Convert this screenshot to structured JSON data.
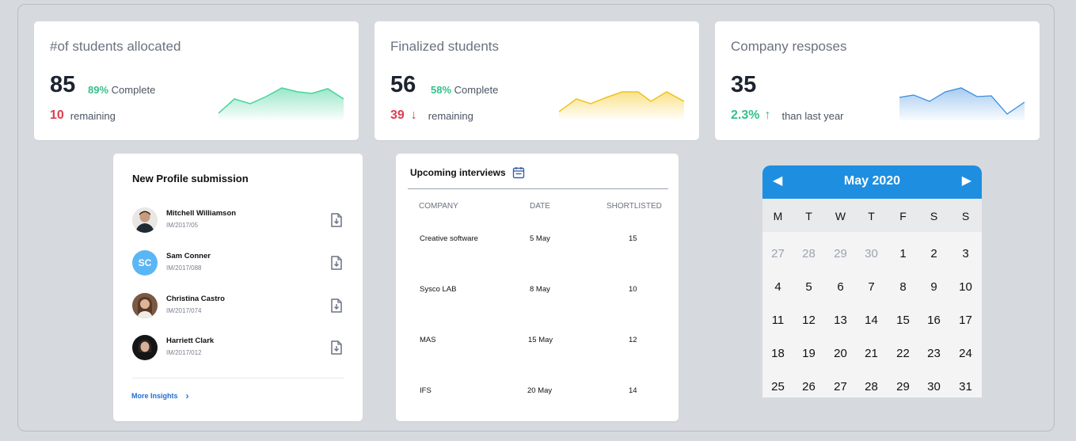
{
  "stats": [
    {
      "title": "#of students allocated",
      "value": "85",
      "percent": "89%",
      "percent_label": "Complete",
      "secondary_value": "10",
      "secondary_label": "remaining",
      "trend": "none",
      "chart_color": "#45d49a"
    },
    {
      "title": "Finalized students",
      "value": "56",
      "percent": "58%",
      "percent_label": "Complete",
      "secondary_value": "39",
      "secondary_label": "remaining",
      "trend": "arrow-down",
      "chart_color": "#f6cf3d"
    },
    {
      "title": "Company resposes",
      "value": "35",
      "secondary_value": "2.3%",
      "secondary_label": "than last year",
      "trend": "arrow-up",
      "chart_color": "#3b8de0"
    }
  ],
  "profiles": {
    "title": "New Profile submission",
    "items": [
      {
        "name": "Mitchell Williamson",
        "id": "IM/2017/05",
        "avatar": "photo"
      },
      {
        "name": "Sam Conner",
        "id": "IM/2017/088",
        "avatar": "SC"
      },
      {
        "name": "Christina Castro",
        "id": "IM/2017/074",
        "avatar": "photo"
      },
      {
        "name": "Harriett Clark",
        "id": "IM/2017/012",
        "avatar": "photo"
      }
    ],
    "more_label": "More Insights"
  },
  "interviews": {
    "title": "Upcoming interviews",
    "columns": [
      "COMPANY",
      "DATE",
      "SHORTLISTED"
    ],
    "rows": [
      {
        "company": "Creative software",
        "date": "5 May",
        "shortlisted": "15"
      },
      {
        "company": "Sysco LAB",
        "date": "8 May",
        "shortlisted": "10"
      },
      {
        "company": "MAS",
        "date": "15 May",
        "shortlisted": "12"
      },
      {
        "company": "IFS",
        "date": "20 May",
        "shortlisted": "14"
      }
    ]
  },
  "calendar": {
    "month_label": "May 2020",
    "weekdays": [
      "M",
      "T",
      "W",
      "T",
      "F",
      "S",
      "S"
    ],
    "weeks": [
      [
        {
          "d": "27",
          "m": true
        },
        {
          "d": "28",
          "m": true
        },
        {
          "d": "29",
          "m": true
        },
        {
          "d": "30",
          "m": true
        },
        {
          "d": "1"
        },
        {
          "d": "2"
        },
        {
          "d": "3"
        }
      ],
      [
        {
          "d": "4"
        },
        {
          "d": "5"
        },
        {
          "d": "6"
        },
        {
          "d": "7"
        },
        {
          "d": "8"
        },
        {
          "d": "9"
        },
        {
          "d": "10"
        }
      ],
      [
        {
          "d": "11"
        },
        {
          "d": "12"
        },
        {
          "d": "13"
        },
        {
          "d": "14"
        },
        {
          "d": "15"
        },
        {
          "d": "16"
        },
        {
          "d": "17"
        }
      ],
      [
        {
          "d": "18"
        },
        {
          "d": "19"
        },
        {
          "d": "20"
        },
        {
          "d": "21"
        },
        {
          "d": "22"
        },
        {
          "d": "23"
        },
        {
          "d": "24"
        }
      ],
      [
        {
          "d": "25"
        },
        {
          "d": "26"
        },
        {
          "d": "27"
        },
        {
          "d": "28"
        },
        {
          "d": "29"
        },
        {
          "d": "30"
        },
        {
          "d": "31"
        }
      ]
    ]
  }
}
